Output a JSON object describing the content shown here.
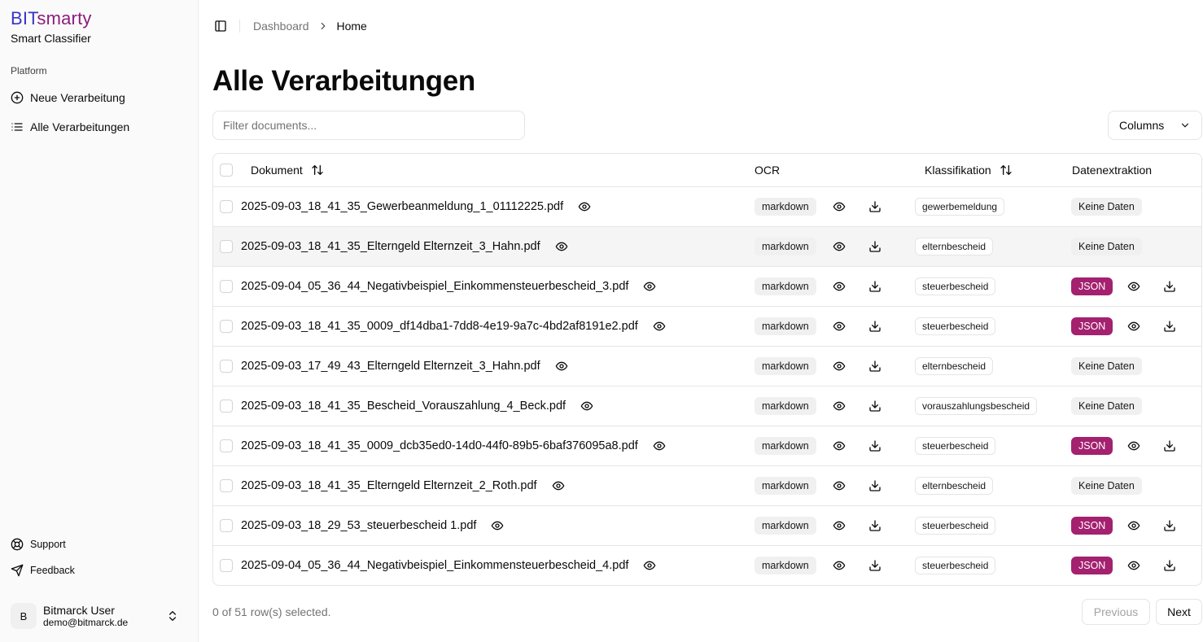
{
  "brand": {
    "name_part1": "BIT",
    "name_part2": "smarty",
    "subtitle": "Smart Classifier"
  },
  "sidebar": {
    "section_label": "Platform",
    "items": [
      {
        "label": "Neue Verarbeitung",
        "icon": "plus-circle-icon"
      },
      {
        "label": "Alle Verarbeitungen",
        "icon": "list-icon"
      }
    ],
    "footer": [
      {
        "label": "Support",
        "icon": "life-buoy-icon"
      },
      {
        "label": "Feedback",
        "icon": "send-icon"
      }
    ],
    "user": {
      "initial": "B",
      "name": "Bitmarck User",
      "email": "demo@bitmarck.de"
    }
  },
  "breadcrumb": {
    "parent": "Dashboard",
    "current": "Home"
  },
  "page": {
    "title": "Alle Verarbeitungen"
  },
  "toolbar": {
    "filter_placeholder": "Filter documents...",
    "columns_label": "Columns"
  },
  "table": {
    "headers": {
      "document": "Dokument",
      "ocr": "OCR",
      "classification": "Klassifikation",
      "extraction": "Datenextraktion"
    },
    "rows": [
      {
        "file": "2025-09-03_18_41_35_Gewerbeanmeldung_1_01112225.pdf",
        "ocr": "markdown",
        "class": "gewerbemeldung",
        "extraction": "Keine Daten",
        "has_json": false
      },
      {
        "file": "2025-09-03_18_41_35_Elterngeld Elternzeit_3_Hahn.pdf",
        "ocr": "markdown",
        "class": "elternbescheid",
        "extraction": "Keine Daten",
        "has_json": false
      },
      {
        "file": "2025-09-04_05_36_44_Negativbeispiel_Einkommensteuerbescheid_3.pdf",
        "ocr": "markdown",
        "class": "steuerbescheid",
        "extraction": "JSON",
        "has_json": true
      },
      {
        "file": "2025-09-03_18_41_35_0009_df14dba1-7dd8-4e19-9a7c-4bd2af8191e2.pdf",
        "ocr": "markdown",
        "class": "steuerbescheid",
        "extraction": "JSON",
        "has_json": true
      },
      {
        "file": "2025-09-03_17_49_43_Elterngeld Elternzeit_3_Hahn.pdf",
        "ocr": "markdown",
        "class": "elternbescheid",
        "extraction": "Keine Daten",
        "has_json": false
      },
      {
        "file": "2025-09-03_18_41_35_Bescheid_Vorauszahlung_4_Beck.pdf",
        "ocr": "markdown",
        "class": "vorauszahlungsbescheid",
        "extraction": "Keine Daten",
        "has_json": false
      },
      {
        "file": "2025-09-03_18_41_35_0009_dcb35ed0-14d0-44f0-89b5-6baf376095a8.pdf",
        "ocr": "markdown",
        "class": "steuerbescheid",
        "extraction": "JSON",
        "has_json": true
      },
      {
        "file": "2025-09-03_18_41_35_Elterngeld Elternzeit_2_Roth.pdf",
        "ocr": "markdown",
        "class": "elternbescheid",
        "extraction": "Keine Daten",
        "has_json": false
      },
      {
        "file": "2025-09-03_18_29_53_steuerbescheid 1.pdf",
        "ocr": "markdown",
        "class": "steuerbescheid",
        "extraction": "JSON",
        "has_json": true
      },
      {
        "file": "2025-09-04_05_36_44_Negativbeispiel_Einkommensteuerbescheid_4.pdf",
        "ocr": "markdown",
        "class": "steuerbescheid",
        "extraction": "JSON",
        "has_json": true
      }
    ]
  },
  "pagination": {
    "selection_text": "0 of 51 row(s) selected.",
    "prev_label": "Previous",
    "next_label": "Next"
  },
  "colors": {
    "brand_blue": "#3a35c8",
    "brand_magenta": "#8a1e7c",
    "json_badge": "#a3216f"
  }
}
